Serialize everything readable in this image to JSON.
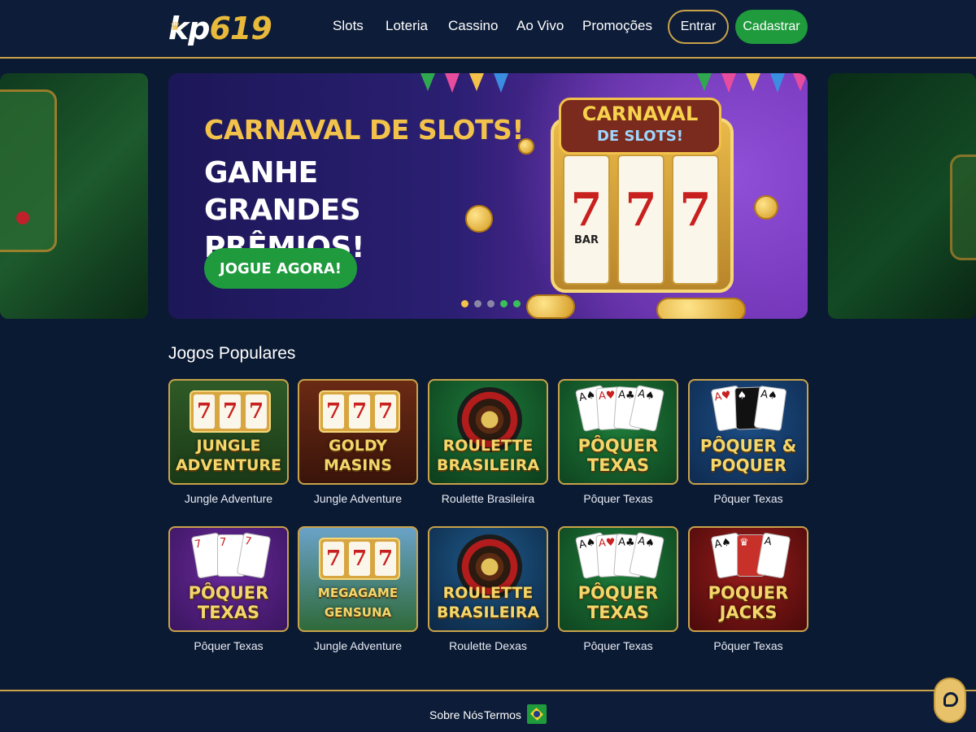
{
  "brand": {
    "logo_prefix": "kp",
    "logo_number": "619"
  },
  "nav": {
    "items": [
      {
        "label": "Slots"
      },
      {
        "label": "Loteria"
      },
      {
        "label": "Cassino"
      },
      {
        "label": "Ao Vivo"
      },
      {
        "label": "Promoções"
      }
    ],
    "login_label": "Entrar",
    "register_label": "Cadastrar"
  },
  "banner": {
    "title_line1": "CARNAVAL DE SLOTS!",
    "title_line2": "GANHE GRANDES PRÊMIOS!",
    "cta_label": "JOGUE AGORA!",
    "sign_line1": "CARNAVAL",
    "sign_line2": "DE SLOTS!",
    "reel_symbol": "7",
    "bar_symbol": "BAR",
    "slide_count": 5,
    "active_slide": 1
  },
  "popular": {
    "title": "Jogos Populares",
    "games": [
      {
        "art": "JUNGLE ADVENTURE",
        "label": "Jungle Adventure"
      },
      {
        "art": "GOLDY MASINS",
        "label": "Jungle Adventure"
      },
      {
        "art": "ROULETTE BRASILEIRA",
        "label": "Roulette Brasileira"
      },
      {
        "art": "PÔQUER TEXAS",
        "label": "Pôquer Texas"
      },
      {
        "art": "PÔQUER & POQUER",
        "label": "Pôquer Texas"
      },
      {
        "art": "PÔQUER TEXAS",
        "label": "Pôquer Texas"
      },
      {
        "art": "MEGAGAME GENSUNA",
        "label": "Jungle Adventure"
      },
      {
        "art": "ROULETTE BRASILEIRA",
        "label": "Roulette Dexas"
      },
      {
        "art": "PÔQUER TEXAS",
        "label": "Pôquer Texas"
      },
      {
        "art": "POQUER JACKS",
        "label": "Pôquer Texas"
      }
    ]
  },
  "footer": {
    "about_label": "Sobre Nós",
    "terms_label": "Termos"
  },
  "colors": {
    "background": "#0b1a33",
    "accent_gold": "#c9a24a",
    "brand_green": "#1f9a3d"
  },
  "icons": [
    "crown-icon",
    "brazil-flag-icon",
    "chat-icon"
  ]
}
